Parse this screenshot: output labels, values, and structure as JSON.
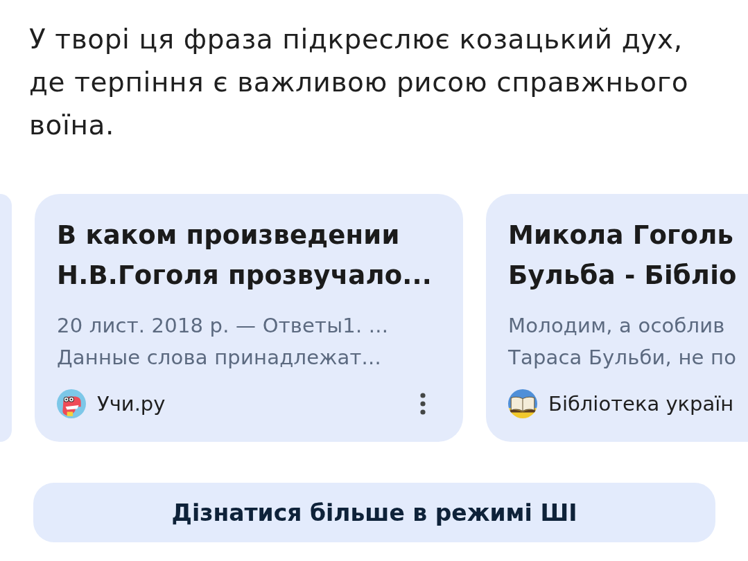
{
  "answer_text": "У творі ця фраза підкреслює козацький дух, де терпіння є важливою рисою справжнього воїна.",
  "result_cards": [
    {
      "title_lines": [
        "В каком произведении",
        "Н.В.Гоголя прозвучало..."
      ],
      "snippet_lines": [
        "20 лист. 2018 р. — Ответы1. ...",
        "Данные слова принадлежат..."
      ],
      "source": {
        "name": "Учи.ру"
      },
      "more_button": true
    },
    {
      "title_lines": [
        "Микола Гоголь",
        "Бульба - Бібліо"
      ],
      "snippet_lines": [
        "Молодим, а особлив",
        "Тараса Бульби, не по"
      ],
      "source": {
        "name": "Бібліотека україн"
      },
      "more_button": false
    }
  ],
  "button": {
    "label": "Дізнатися більше в режимі ШІ"
  }
}
